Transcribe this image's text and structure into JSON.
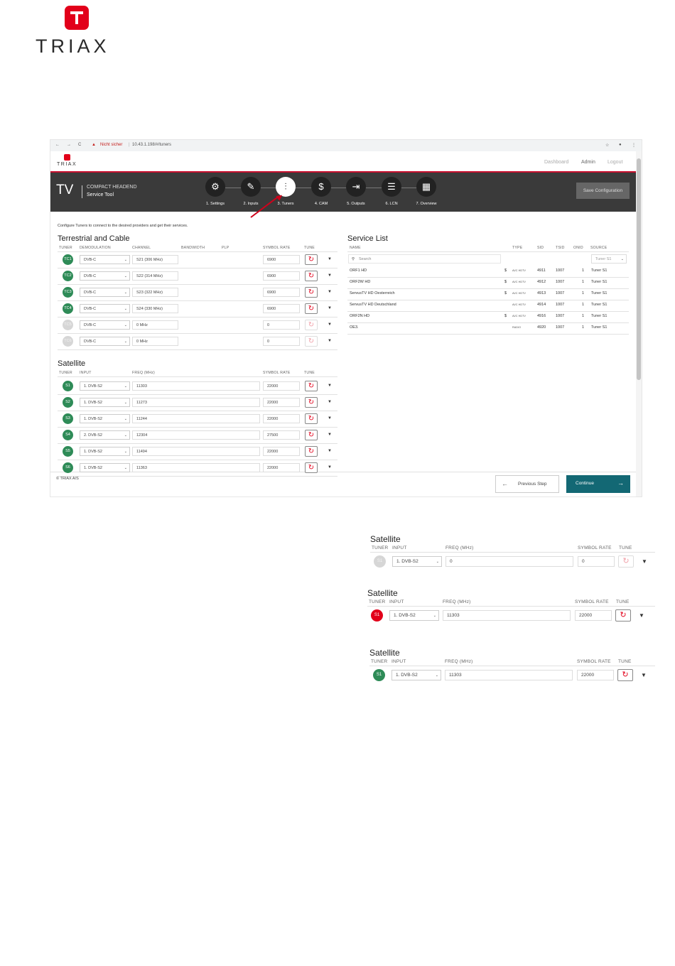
{
  "logo": {
    "word": "TRIAX"
  },
  "browser": {
    "nav_back": "←",
    "nav_forward": "→",
    "reload": "C",
    "security_warning": "Nicht sicher",
    "url": "10.43.1.198/#/tuners",
    "star": "☆",
    "profile": "●",
    "menu": "⋮"
  },
  "app": {
    "mini_logo": "TRIAX",
    "links": [
      "Dashboard",
      "Admin",
      "Logout"
    ],
    "product_big": "TV",
    "product_title": "COMPACT HEADEND",
    "product_sub": "Service Tool",
    "steps": [
      {
        "label": "1. Settings",
        "icon": "⚙"
      },
      {
        "label": "2. Inputs",
        "icon": "✎"
      },
      {
        "label": "3. Tuners",
        "icon": "⫶"
      },
      {
        "label": "4. CAM",
        "icon": "$"
      },
      {
        "label": "5. Outputs",
        "icon": "⇥"
      },
      {
        "label": "6. LCN",
        "icon": "☰"
      },
      {
        "label": "7. Overview",
        "icon": "▦"
      }
    ],
    "save_config": "Save Configuration",
    "intro": "Configure Tuners to connect to the desired providers and get their services.",
    "terrestrial": {
      "title": "Terrestrial and Cable",
      "headers": [
        "TUNER",
        "DEMODULATION",
        "CHANNEL",
        "BANDWIDTH",
        "PLP",
        "SYMBOL RATE",
        "TUNE"
      ],
      "rows": [
        {
          "tuner": "TC1",
          "demod": "DVB-C",
          "channel": "S21 (306 MHz)",
          "symbol": "6900",
          "active": true
        },
        {
          "tuner": "TC2",
          "demod": "DVB-C",
          "channel": "S22 (314 MHz)",
          "symbol": "6900",
          "active": true
        },
        {
          "tuner": "TC3",
          "demod": "DVB-C",
          "channel": "S23 (322 MHz)",
          "symbol": "6900",
          "active": true
        },
        {
          "tuner": "TC4",
          "demod": "DVB-C",
          "channel": "S24 (330 MHz)",
          "symbol": "6900",
          "active": true
        },
        {
          "tuner": "TC5",
          "demod": "DVB-C",
          "channel": "0 MHz",
          "symbol": "0",
          "active": false
        },
        {
          "tuner": "TC6",
          "demod": "DVB-C",
          "channel": "0 MHz",
          "symbol": "0",
          "active": false
        }
      ]
    },
    "satellite": {
      "title": "Satellite",
      "headers": [
        "TUNER",
        "INPUT",
        "FREQ (MHz)",
        "SYMBOL RATE",
        "TUNE"
      ],
      "rows": [
        {
          "tuner": "S1",
          "input": "1. DVB-S2",
          "freq": "11303",
          "symbol": "22000"
        },
        {
          "tuner": "S2",
          "input": "1. DVB-S2",
          "freq": "11273",
          "symbol": "22000"
        },
        {
          "tuner": "S3",
          "input": "1. DVB-S2",
          "freq": "11244",
          "symbol": "22000"
        },
        {
          "tuner": "S4",
          "input": "2. DVB-S2",
          "freq": "12304",
          "symbol": "27500"
        },
        {
          "tuner": "S5",
          "input": "1. DVB-S2",
          "freq": "11494",
          "symbol": "22000"
        },
        {
          "tuner": "S6",
          "input": "1. DVB-S2",
          "freq": "11363",
          "symbol": "22000"
        }
      ]
    },
    "services": {
      "title": "Service List",
      "headers": [
        "NAME",
        "TYPE",
        "SID",
        "TSID",
        "ONID",
        "SOURCE"
      ],
      "search_placeholder": "Search",
      "source_filter": "Tuner S1",
      "rows": [
        {
          "name": "ORF1 HD",
          "scrambled": "$",
          "type": "AVC HDTV",
          "sid": "4911",
          "tsid": "1007",
          "onid": "1",
          "source": "Tuner S1"
        },
        {
          "name": "ORF2W HD",
          "scrambled": "$",
          "type": "AVC HDTV",
          "sid": "4912",
          "tsid": "1007",
          "onid": "1",
          "source": "Tuner S1"
        },
        {
          "name": "ServusTV HD Oesterreich",
          "scrambled": "$",
          "type": "AVC HDTV",
          "sid": "4913",
          "tsid": "1007",
          "onid": "1",
          "source": "Tuner S1"
        },
        {
          "name": "ServusTV HD Deutschland",
          "scrambled": "",
          "type": "AVC HDTV",
          "sid": "4914",
          "tsid": "1007",
          "onid": "1",
          "source": "Tuner S1"
        },
        {
          "name": "ORF2N HD",
          "scrambled": "$",
          "type": "AVC HDTV",
          "sid": "4916",
          "tsid": "1007",
          "onid": "1",
          "source": "Tuner S1"
        },
        {
          "name": "OE3.",
          "scrambled": "",
          "type": "RADIO",
          "sid": "4920",
          "tsid": "1007",
          "onid": "1",
          "source": "Tuner S1"
        }
      ]
    },
    "copyright": "© TRIAX A/S",
    "previous_step": "Previous Step",
    "continue": "Continue"
  },
  "crops": [
    {
      "title": "Satellite",
      "tuner": "S1",
      "input": "1. DVB-S2",
      "freq": "0",
      "symbol": "0",
      "state": "off"
    },
    {
      "title": "Satellite",
      "tuner": "S1",
      "input": "1. DVB-S2",
      "freq": "11303",
      "symbol": "22000",
      "state": "red"
    },
    {
      "title": "Satellite",
      "tuner": "S1",
      "input": "1. DVB-S2",
      "freq": "11303",
      "symbol": "22000",
      "state": "green"
    }
  ],
  "crop_headers": [
    "TUNER",
    "INPUT",
    "FREQ (MHz)",
    "SYMBOL RATE",
    "TUNE"
  ],
  "glyphs": {
    "tune": "↻",
    "dropdown": "▼",
    "chevron": "⌄",
    "search": "⚲",
    "arrow_left": "←",
    "arrow_right": "→"
  }
}
